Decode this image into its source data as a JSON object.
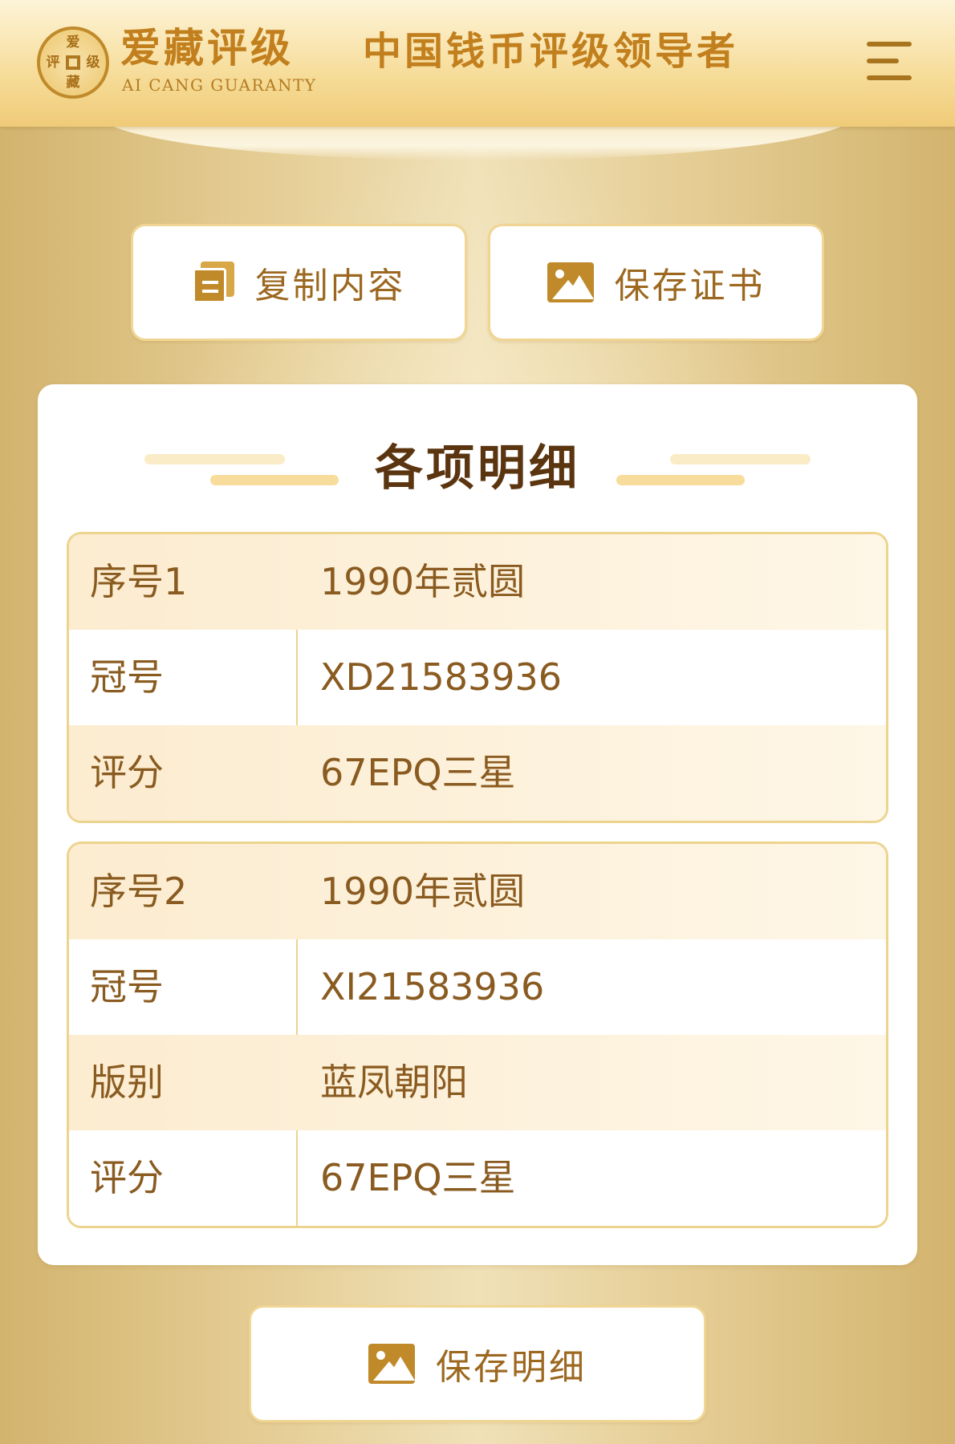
{
  "header": {
    "brand_cn": "爱藏评级",
    "brand_en": "AI CANG GUARANTY",
    "slogan": "中国钱币评级领导者",
    "logo_chars": [
      "爱",
      "藏",
      "评",
      "级"
    ],
    "menu_icon": "hamburger-menu-icon"
  },
  "actions": {
    "copy_label": "复制内容",
    "copy_icon": "copy-document-icon",
    "save_cert_label": "保存证书",
    "save_cert_icon": "image-icon"
  },
  "details": {
    "title": "各项明细",
    "groups": [
      {
        "rows": [
          {
            "label": "序号1",
            "value": "1990年贰圆"
          },
          {
            "label": "冠号",
            "value": "XD21583936"
          },
          {
            "label": "评分",
            "value": "67EPQ三星"
          }
        ]
      },
      {
        "rows": [
          {
            "label": "序号2",
            "value": "1990年贰圆"
          },
          {
            "label": "冠号",
            "value": "XI21583936"
          },
          {
            "label": "版别",
            "value": "蓝凤朝阳"
          },
          {
            "label": "评分",
            "value": "67EPQ三星"
          }
        ]
      }
    ]
  },
  "footer": {
    "save_detail_label": "保存明细",
    "save_detail_icon": "image-icon"
  },
  "colors": {
    "accent": "#c27f1d",
    "text_brown": "#8a5b20",
    "border_gold": "#edd48e"
  }
}
